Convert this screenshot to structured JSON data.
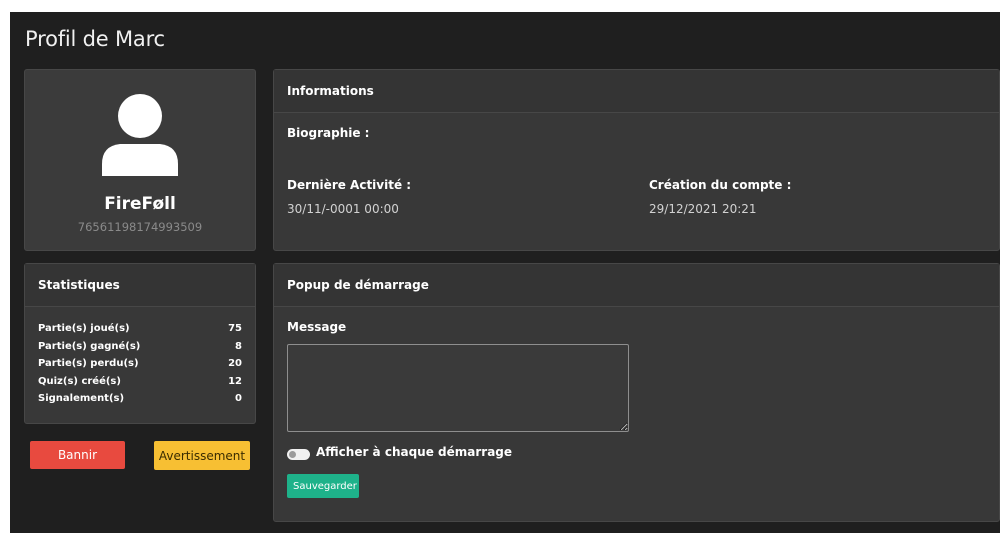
{
  "page": {
    "title": "Profil de Marc"
  },
  "profile": {
    "avatar_icon": "user-silhouette-icon",
    "username": "FireFøll",
    "steam_id": "76561198174993509"
  },
  "stats": {
    "title": "Statistiques",
    "rows": [
      {
        "label": "Partie(s) joué(s)",
        "value": "75"
      },
      {
        "label": "Partie(s) gagné(s)",
        "value": "8"
      },
      {
        "label": "Partie(s) perdu(s)",
        "value": "20"
      },
      {
        "label": "Quiz(s) créé(s)",
        "value": "12"
      },
      {
        "label": "Signalement(s)",
        "value": "0"
      }
    ]
  },
  "actions": {
    "ban_label": "Bannir",
    "warn_label": "Avertissement",
    "ban_color": "#e84a3f",
    "warn_color": "#f7bf33"
  },
  "info": {
    "title": "Informations",
    "bio_label": "Biographie :",
    "last_activity_label": "Dernière Activité :",
    "last_activity_value": "30/11/-0001 00:00",
    "created_label": "Création du compte :",
    "created_value": "29/12/2021 20:21"
  },
  "popup": {
    "title": "Popup de démarrage",
    "message_label": "Message",
    "message_value": "",
    "toggle_label": "Afficher à chaque démarrage",
    "toggle_on": false,
    "save_label": "Sauvegarder",
    "save_color": "#1eb28a"
  }
}
